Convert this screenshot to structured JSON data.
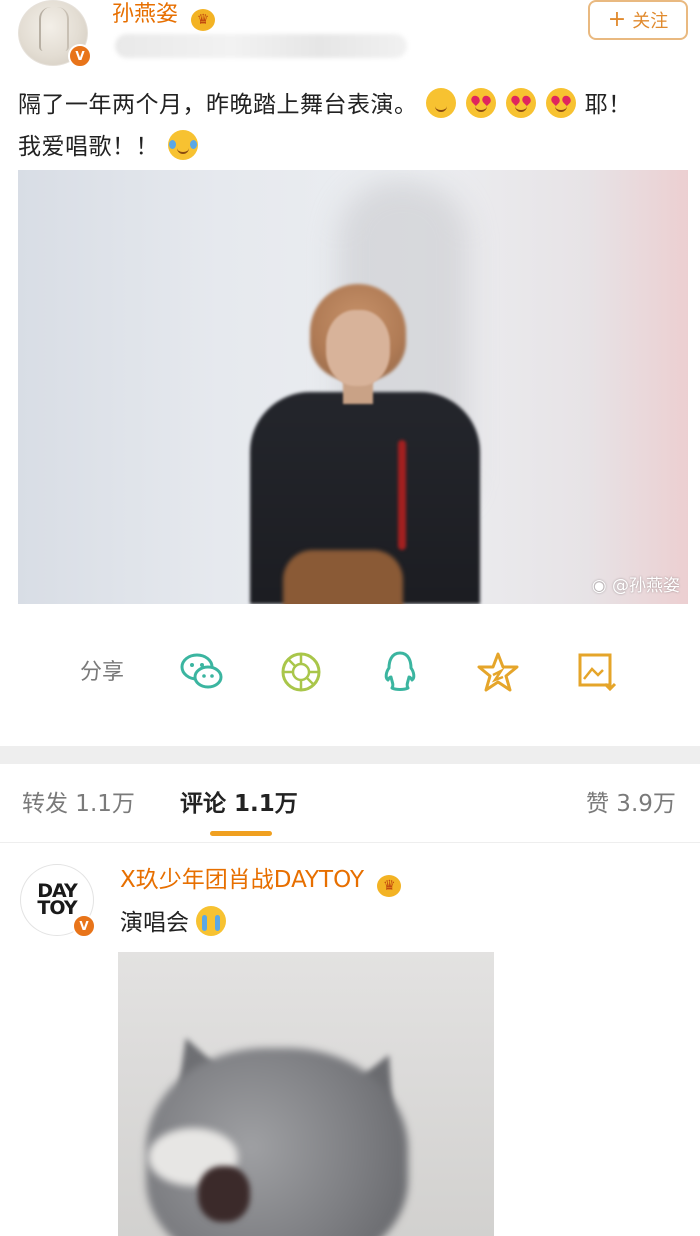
{
  "post": {
    "author": {
      "name": "孙燕姿",
      "verified_badge": "V"
    },
    "follow_label": "关注",
    "text_line1": "隔了一年两个月，昨晚踏上舞台表演。",
    "text_line1_tail": "耶！",
    "text_line2": "我爱唱歌！！",
    "emojis": [
      "shy-smile-icon",
      "heart-eyes-icon",
      "heart-eyes-icon",
      "heart-eyes-icon",
      "laugh-cry-icon"
    ],
    "image_watermark": "@孙燕姿"
  },
  "share": {
    "label": "分享",
    "icons": [
      "wechat-icon",
      "moments-icon",
      "qq-icon",
      "favorite-star-icon",
      "save-image-icon"
    ]
  },
  "tabs": {
    "repost": "转发 1.1万",
    "comment": "评论 1.1万",
    "like": "赞 3.9万",
    "active": "comment"
  },
  "comment": {
    "author": "X玖少年团肖战DAYTOY",
    "avatar_text": [
      "DAY",
      "TOY"
    ],
    "verified_badge": "V",
    "text": "演唱会"
  },
  "colors": {
    "username_orange": "#e76f00",
    "accent": "#f0a020",
    "share_icon_green": "#3bb5a0",
    "share_icon_gold": "#e5a52a"
  }
}
